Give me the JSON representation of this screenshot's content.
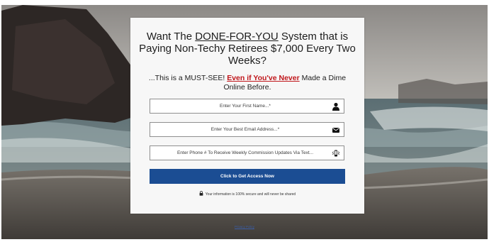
{
  "headline": {
    "prefix": "Want The ",
    "emphasis": "DONE-FOR-YOU",
    "suffix": " System that is Paying Non-Techy Retirees $7,000 Every Two Weeks?"
  },
  "subheadline": {
    "prefix": "...This is a MUST-SEE! ",
    "emphasis": "Even if You've Never",
    "suffix": " Made a Dime Online Before."
  },
  "form": {
    "first_name": {
      "placeholder": "Enter Your First Name...*",
      "icon": "user-icon"
    },
    "email": {
      "placeholder": "Enter Your Best Email Address...*",
      "icon": "envelope-icon"
    },
    "phone": {
      "placeholder": "Enter Phone # To Receive Weekly Commission Updates Via Text...",
      "icon": "phone-vibrate-icon"
    },
    "submit_label": "Click to Get Access Now",
    "secure_note": "Your information is 100% secure and will never be shared",
    "secure_icon": "lock-icon"
  },
  "footer": {
    "link_label": "Privacy Policy"
  },
  "colors": {
    "cta_background": "#1b4d93",
    "emphasis_red": "#c0161b",
    "card_background": "#f7f7f7"
  }
}
